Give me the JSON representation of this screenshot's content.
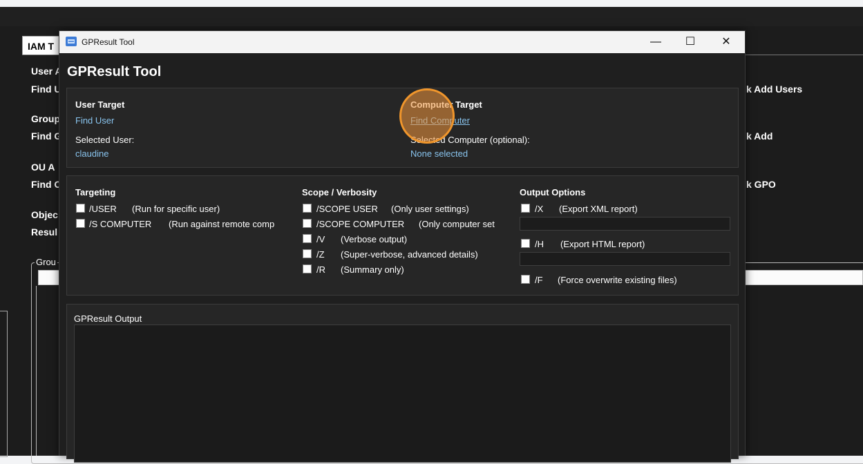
{
  "background_app": {
    "tab_label": "IAM T",
    "left_labels": [
      "User A",
      "Find U",
      "Group",
      "Find G",
      "OU A",
      "Find O",
      "Objec",
      "Resul"
    ],
    "right_labels": [
      "k Add Users",
      "k Add",
      "k GPO"
    ],
    "group_legend": "Grou"
  },
  "dialog": {
    "window_title": "GPResult Tool",
    "heading": "GPResult Tool",
    "minimize_glyph": "—",
    "maximize_glyph": "☐",
    "close_glyph": "✕",
    "user_target": {
      "header": "User Target",
      "find_link": "Find User",
      "selected_label": "Selected User:",
      "selected_value": "claudine"
    },
    "computer_target": {
      "header": "Computer Target",
      "find_link": "Find Computer",
      "selected_label": "Selected Computer (optional):",
      "selected_value": "None selected"
    },
    "targeting": {
      "header": "Targeting",
      "options": [
        {
          "flag": "/USER",
          "desc": "(Run for specific user)",
          "checked": false
        },
        {
          "flag": "/S COMPUTER",
          "desc": "(Run against remote comp",
          "checked": false
        }
      ]
    },
    "scope": {
      "header": "Scope / Verbosity",
      "options": [
        {
          "flag": "/SCOPE USER",
          "desc": "(Only user settings)",
          "checked": false
        },
        {
          "flag": "/SCOPE COMPUTER",
          "desc": "(Only computer set",
          "checked": false
        },
        {
          "flag": "/V",
          "desc": "(Verbose output)",
          "checked": false
        },
        {
          "flag": "/Z",
          "desc": "(Super-verbose, advanced details)",
          "checked": false
        },
        {
          "flag": "/R",
          "desc": "(Summary only)",
          "checked": false
        }
      ]
    },
    "output_options": {
      "header": "Output Options",
      "x": {
        "flag": "/X",
        "desc": "(Export XML report)",
        "checked": false,
        "path": ""
      },
      "h": {
        "flag": "/H",
        "desc": "(Export HTML report)",
        "checked": false,
        "path": ""
      },
      "f": {
        "flag": "/F",
        "desc": "(Force overwrite existing files)",
        "checked": false
      }
    },
    "output": {
      "label": "GPResult Output",
      "text": ""
    }
  },
  "colors": {
    "link": "#89c4ee",
    "highlight": "#f0962c"
  }
}
